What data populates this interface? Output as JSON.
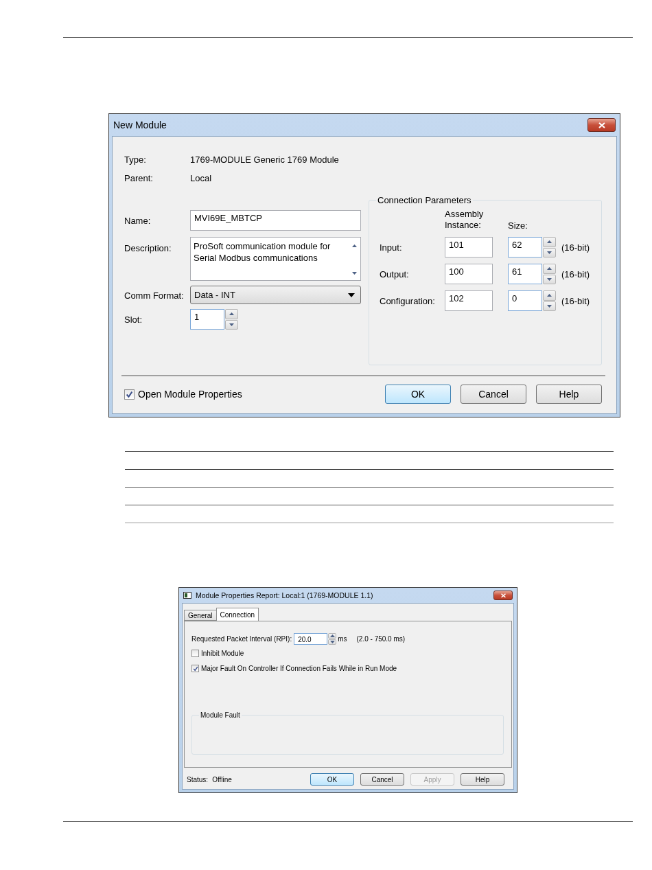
{
  "new_module": {
    "title": "New Module",
    "type": {
      "label": "Type:",
      "value": "1769-MODULE Generic 1769 Module"
    },
    "parent": {
      "label": "Parent:",
      "value": "Local"
    },
    "name": {
      "label": "Name:",
      "value": "MVI69E_MBTCP"
    },
    "description": {
      "label": "Description:",
      "value": "ProSoft communication module for Serial Modbus communications"
    },
    "comm_format": {
      "label": "Comm Format:",
      "value": "Data - INT"
    },
    "slot": {
      "label": "Slot:",
      "value": "1"
    },
    "connection_parameters": {
      "title": "Connection Parameters",
      "instance_header": "Assembly Instance:",
      "size_header": "Size:",
      "rows": [
        {
          "label": "Input:",
          "instance": "101",
          "size": "62",
          "unit": "(16-bit)"
        },
        {
          "label": "Output:",
          "instance": "100",
          "size": "61",
          "unit": "(16-bit)"
        },
        {
          "label": "Configuration:",
          "instance": "102",
          "size": "0",
          "unit": "(16-bit)"
        }
      ]
    },
    "open_module_properties": {
      "label": "Open Module Properties",
      "checked": true
    },
    "buttons": [
      {
        "label": "OK",
        "default": true
      },
      {
        "label": "Cancel",
        "default": false
      },
      {
        "label": "Help",
        "default": false
      }
    ]
  },
  "report": {
    "title": "Module Properties Report: Local:1 (1769-MODULE 1.1)",
    "tabs": [
      {
        "label": "General",
        "selected": false
      },
      {
        "label": "Connection",
        "selected": true
      }
    ],
    "rpi": {
      "label": "Requested Packet Interval (RPI):",
      "value": "20.0",
      "unit": "ms",
      "range": "(2.0 - 750.0 ms)"
    },
    "options": [
      {
        "label": "Inhibit Module",
        "checked": false
      },
      {
        "label": "Major Fault On Controller If Connection Fails While in Run Mode",
        "checked": true
      }
    ],
    "module_fault": {
      "title": "Module Fault"
    },
    "status": {
      "label": "Status:",
      "value": "Offline"
    },
    "buttons": [
      {
        "label": "OK",
        "default": true,
        "disabled": false
      },
      {
        "label": "Cancel",
        "default": false,
        "disabled": false
      },
      {
        "label": "Apply",
        "default": false,
        "disabled": true
      },
      {
        "label": "Help",
        "default": false,
        "disabled": false
      }
    ]
  }
}
